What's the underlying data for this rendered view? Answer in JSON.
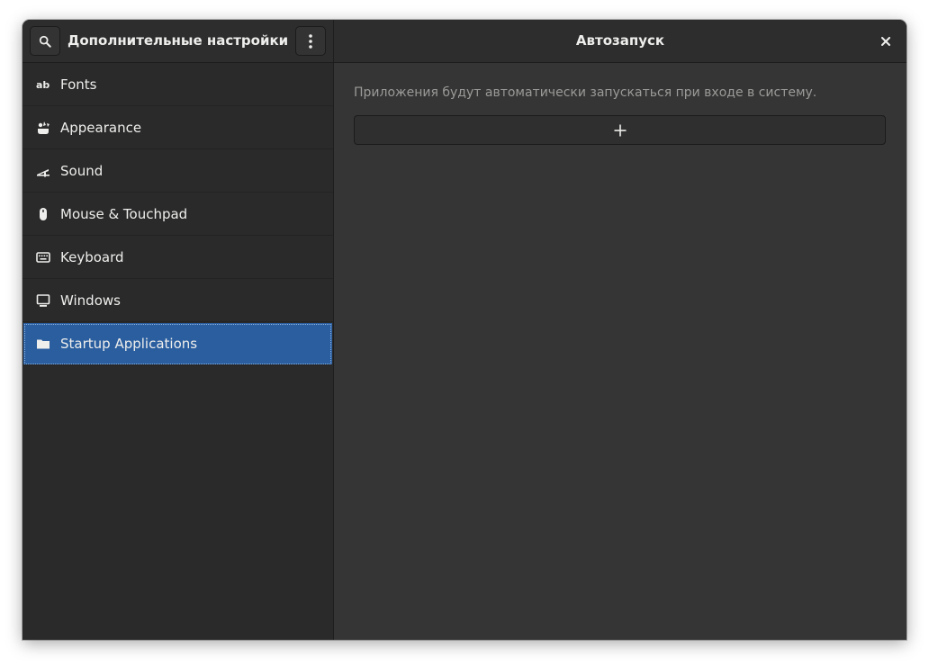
{
  "header": {
    "left_title": "Дополнительные настройки",
    "right_title": "Автозапуск",
    "icons": {
      "search": "search-icon",
      "menu": "vertical-ellipsis-icon",
      "close": "close-icon"
    }
  },
  "sidebar": {
    "items": [
      {
        "label": "Fonts",
        "icon": "fonts-icon"
      },
      {
        "label": "Appearance",
        "icon": "appearance-icon"
      },
      {
        "label": "Sound",
        "icon": "sound-icon"
      },
      {
        "label": "Mouse & Touchpad",
        "icon": "mouse-icon"
      },
      {
        "label": "Keyboard",
        "icon": "keyboard-icon"
      },
      {
        "label": "Windows",
        "icon": "windows-icon"
      },
      {
        "label": "Startup Applications",
        "icon": "folder-icon",
        "selected": true
      }
    ]
  },
  "main": {
    "description": "Приложения будут автоматически запускаться при входе в систему.",
    "add_button_icon": "plus-icon"
  },
  "colors": {
    "accent": "#2a5e9f",
    "window_bg": "#353535",
    "sidebar_bg": "#2a2a2a",
    "header_bg": "#2d2d2d",
    "text": "#eeeeec",
    "dim_text": "#9a9a98"
  }
}
